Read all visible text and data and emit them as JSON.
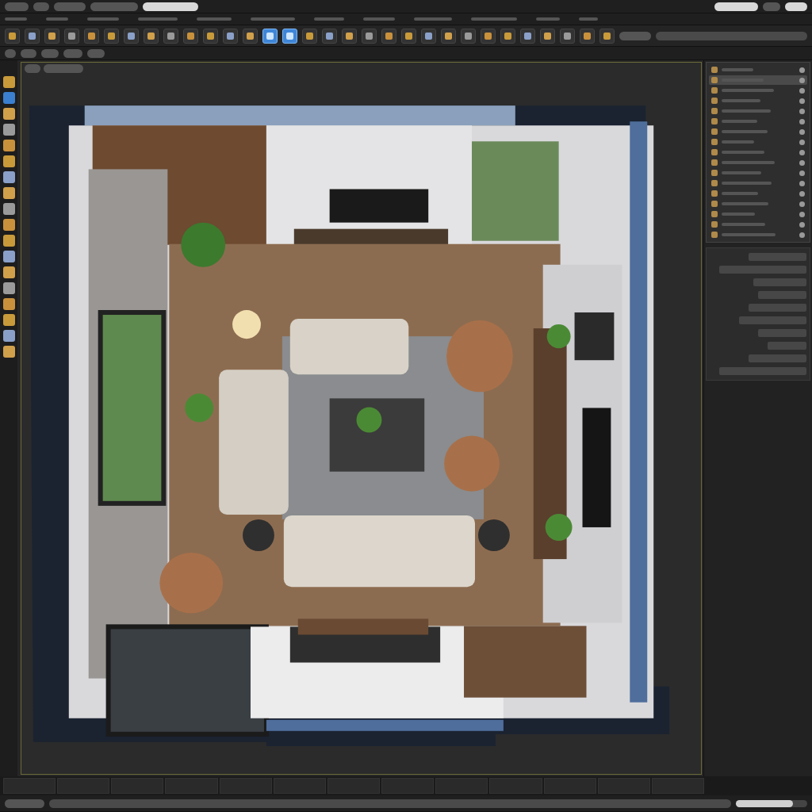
{
  "toolbar": {
    "tools": [
      {
        "selected": false
      },
      {
        "selected": false
      },
      {
        "selected": false
      },
      {
        "selected": false
      },
      {
        "selected": false
      },
      {
        "selected": false
      },
      {
        "selected": false
      },
      {
        "selected": false
      },
      {
        "selected": false
      },
      {
        "selected": false
      },
      {
        "selected": false
      },
      {
        "selected": false
      },
      {
        "selected": false
      },
      {
        "selected": true
      },
      {
        "selected": true
      },
      {
        "selected": false
      },
      {
        "selected": false
      },
      {
        "selected": false
      },
      {
        "selected": false
      },
      {
        "selected": false
      },
      {
        "selected": false
      },
      {
        "selected": false
      },
      {
        "selected": false
      },
      {
        "selected": false
      },
      {
        "selected": false
      },
      {
        "selected": false
      },
      {
        "selected": false
      },
      {
        "selected": false
      },
      {
        "selected": false
      },
      {
        "selected": false
      },
      {
        "selected": false
      }
    ]
  },
  "left_tools": [
    {
      "selected": false
    },
    {
      "selected": true
    },
    {
      "selected": false
    },
    {
      "selected": false
    },
    {
      "selected": false
    },
    {
      "selected": false
    },
    {
      "selected": false
    },
    {
      "selected": false
    },
    {
      "selected": false
    },
    {
      "selected": false
    },
    {
      "selected": false
    },
    {
      "selected": false
    },
    {
      "selected": false
    },
    {
      "selected": false
    },
    {
      "selected": false
    },
    {
      "selected": false
    },
    {
      "selected": false
    },
    {
      "selected": false
    }
  ],
  "viewport": {
    "kind": "room-render"
  },
  "outliner": {
    "rows": [
      {
        "selected": false
      },
      {
        "selected": true
      },
      {
        "selected": false
      },
      {
        "selected": false
      },
      {
        "selected": false
      },
      {
        "selected": false
      },
      {
        "selected": false
      },
      {
        "selected": false
      },
      {
        "selected": false
      },
      {
        "selected": false
      },
      {
        "selected": false
      },
      {
        "selected": false
      },
      {
        "selected": false
      },
      {
        "selected": false
      },
      {
        "selected": false
      },
      {
        "selected": false
      },
      {
        "selected": false
      }
    ]
  },
  "status_bar": {
    "zoom_slider": {
      "level": 0.8
    }
  }
}
